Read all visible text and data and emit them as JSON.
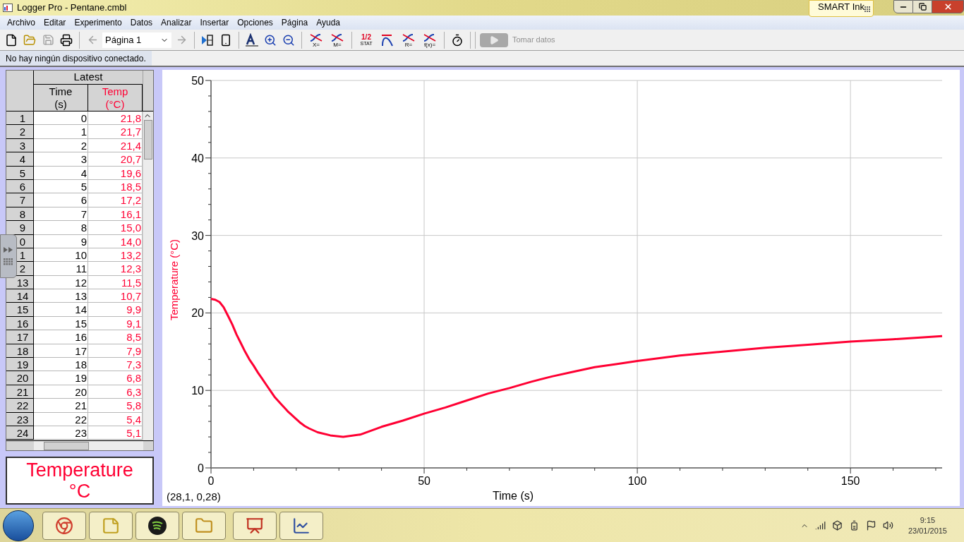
{
  "window": {
    "title": "Logger Pro - Pentane.cmbl"
  },
  "smart_ink": {
    "label": "SMART Ink"
  },
  "menu": [
    "Archivo",
    "Editar",
    "Experimento",
    "Datos",
    "Analizar",
    "Insertar",
    "Opciones",
    "Página",
    "Ayuda"
  ],
  "toolbar": {
    "page_select": {
      "value": "Página 1"
    },
    "analysis_tools": [
      {
        "kind": "curve",
        "label": "X="
      },
      {
        "kind": "curve",
        "label": "M="
      },
      {
        "kind": "stat",
        "top": "1/2",
        "label": "STAT"
      },
      {
        "kind": "tangent"
      },
      {
        "kind": "curve",
        "label": "R="
      },
      {
        "kind": "curve",
        "label": "f(x)="
      }
    ],
    "take_data": {
      "label": "Tomar datos",
      "disabled": true
    }
  },
  "status": "No hay ningún dispositivo conectado.",
  "table": {
    "group": "Latest",
    "columns": [
      {
        "name": "Time",
        "unit": "(s)",
        "color": "#000000"
      },
      {
        "name": "Temp",
        "unit": "(°C)",
        "color": "#ff0033"
      }
    ],
    "rows": [
      [
        "1",
        "0",
        "21,8"
      ],
      [
        "2",
        "1",
        "21,7"
      ],
      [
        "3",
        "2",
        "21,4"
      ],
      [
        "4",
        "3",
        "20,7"
      ],
      [
        "5",
        "4",
        "19,6"
      ],
      [
        "6",
        "5",
        "18,5"
      ],
      [
        "7",
        "6",
        "17,2"
      ],
      [
        "8",
        "7",
        "16,1"
      ],
      [
        "9",
        "8",
        "15,0"
      ],
      [
        "0",
        "9",
        "14,0"
      ],
      [
        "1",
        "10",
        "13,2"
      ],
      [
        "2",
        "11",
        "12,3"
      ],
      [
        "13",
        "12",
        "11,5"
      ],
      [
        "14",
        "13",
        "10,7"
      ],
      [
        "15",
        "14",
        "9,9"
      ],
      [
        "16",
        "15",
        "9,1"
      ],
      [
        "17",
        "16",
        "8,5"
      ],
      [
        "18",
        "17",
        "7,9"
      ],
      [
        "19",
        "18",
        "7,3"
      ],
      [
        "20",
        "19",
        "6,8"
      ],
      [
        "21",
        "20",
        "6,3"
      ],
      [
        "22",
        "21",
        "5,8"
      ],
      [
        "23",
        "22",
        "5,4"
      ],
      [
        "24",
        "23",
        "5,1"
      ]
    ]
  },
  "meter": {
    "label": "Temperature",
    "unit": "°C"
  },
  "graph": {
    "coordinates": "(28,1, 0,28)",
    "chart_data": {
      "type": "line",
      "xlabel": "Time (s)",
      "ylabel": "Temperature (°C)",
      "x": [
        0,
        1,
        2,
        3,
        4,
        5,
        6,
        7,
        8,
        9,
        10,
        11,
        12,
        13,
        14,
        15,
        16,
        17,
        18,
        19,
        20,
        21,
        22,
        23,
        25,
        28,
        31,
        35,
        40,
        45,
        50,
        55,
        60,
        65,
        70,
        75,
        80,
        85,
        90,
        95,
        100,
        110,
        120,
        130,
        140,
        150,
        160,
        171.5
      ],
      "grid": true,
      "series": [
        {
          "color": "#ff0033",
          "values": [
            21.8,
            21.7,
            21.4,
            20.7,
            19.6,
            18.5,
            17.2,
            16.1,
            15.0,
            14.0,
            13.2,
            12.3,
            11.5,
            10.7,
            9.9,
            9.1,
            8.5,
            7.9,
            7.3,
            6.8,
            6.3,
            5.8,
            5.4,
            5.1,
            4.6,
            4.2,
            4.0,
            4.3,
            5.3,
            6.1,
            7.0,
            7.8,
            8.7,
            9.6,
            10.3,
            11.1,
            11.8,
            12.4,
            13.0,
            13.4,
            13.8,
            14.5,
            15.0,
            15.5,
            15.9,
            16.3,
            16.6,
            17.0
          ]
        }
      ],
      "xlim": [
        0,
        171.5
      ],
      "ylim": [
        0,
        50
      ],
      "xticks": [
        0,
        50,
        100,
        150
      ],
      "yticks": [
        0,
        10,
        20,
        30,
        40,
        50
      ]
    }
  },
  "taskbar": {
    "time": "9:15",
    "date": "23/01/2015"
  }
}
